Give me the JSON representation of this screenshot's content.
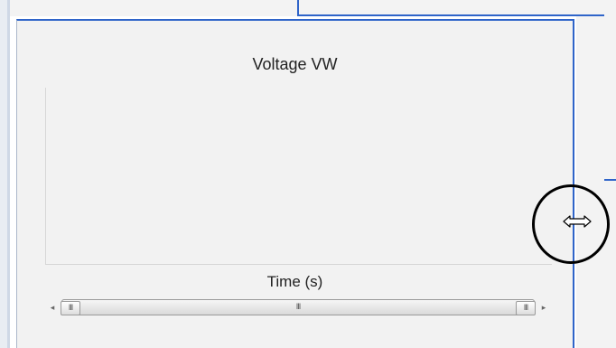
{
  "plot": {
    "title": "Voltage VW",
    "xlabel": "Time (s)"
  },
  "scrollbar": {
    "left_arrow": "◂",
    "right_arrow": "▸",
    "handle_grip": "III",
    "thumb_grip": "III"
  },
  "cursor": {
    "icon": "horizontal-resize-cursor"
  },
  "colors": {
    "accent_border": "#2f64c9",
    "panel_background": "#f2f2f2",
    "annotation": "#000000"
  }
}
